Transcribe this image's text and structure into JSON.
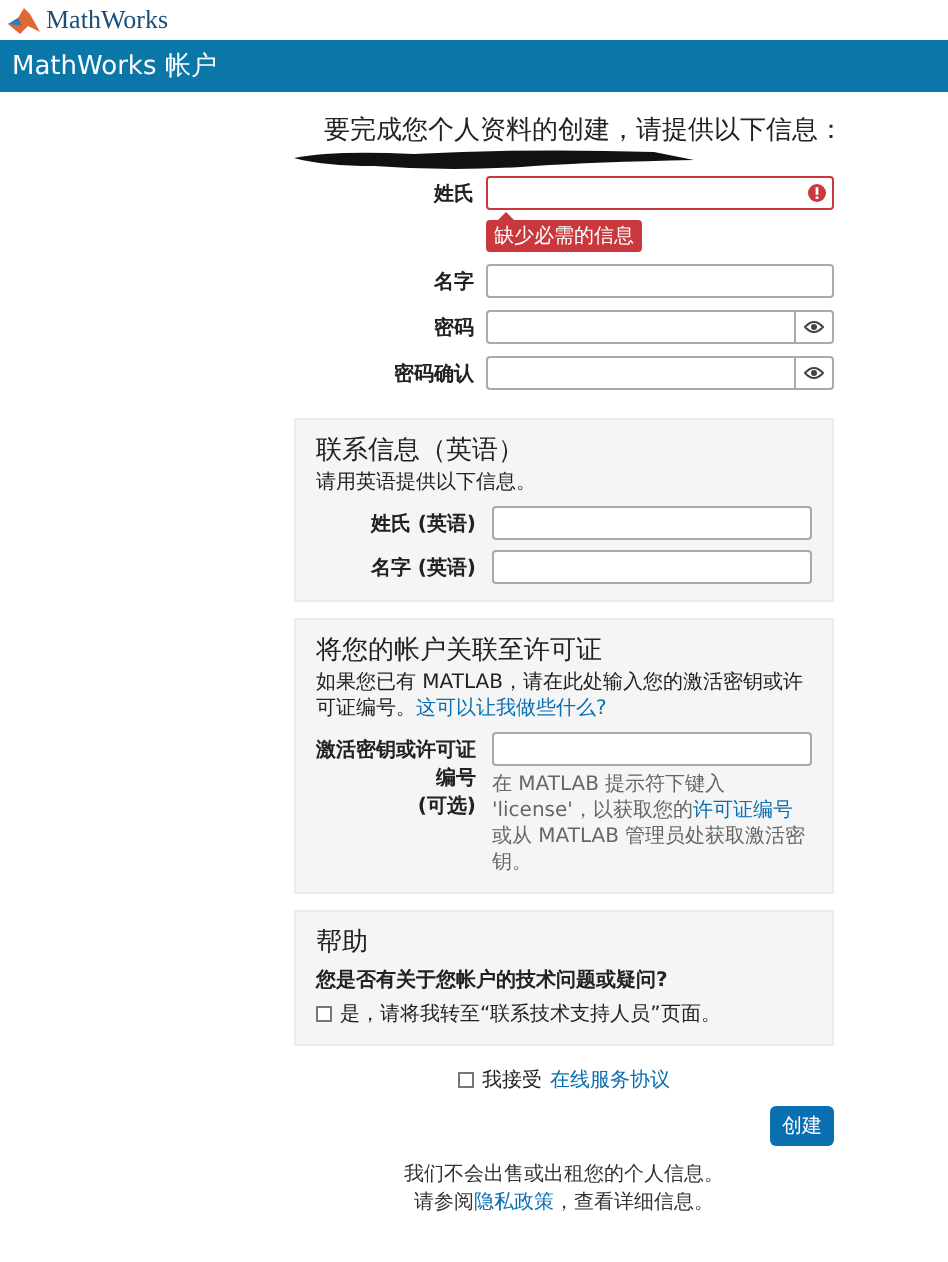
{
  "brand": {
    "logo_text": "MathWorks"
  },
  "header": {
    "title": "MathWorks 帐户"
  },
  "intro": {
    "heading": "要完成您个人资料的创建，请提供以下信息："
  },
  "fields": [
    {
      "label": "姓氏",
      "kind": "text",
      "invalid": true,
      "error": "缺少必需的信息"
    },
    {
      "label": "名字",
      "kind": "text",
      "invalid": false
    },
    {
      "label": "密码",
      "kind": "password",
      "invalid": false
    },
    {
      "label": "密码确认",
      "kind": "password",
      "invalid": false
    }
  ],
  "contact": {
    "title": "联系信息（英语）",
    "note": "请用英语提供以下信息。",
    "fields": [
      {
        "label": "姓氏 (英语)"
      },
      {
        "label": "名字 (英语)"
      }
    ]
  },
  "license": {
    "title": "将您的帐户关联至许可证",
    "description": [
      {
        "kind": "text",
        "text": "如果您已有 MATLAB，请在此处输入您的激活密钥或许可证编号。"
      },
      {
        "kind": "link",
        "text": "这可以让我做些什么?"
      }
    ],
    "field_label": "激活密钥或许可证编号",
    "field_optional": "(可选)",
    "hint": [
      {
        "kind": "text",
        "text": "在 MATLAB 提示符下键入 'license'，以获取您的"
      },
      {
        "kind": "link",
        "text": "许可证编号"
      },
      {
        "kind": "text",
        "text": "或从 MATLAB 管理员处获取激活密钥。"
      }
    ]
  },
  "help": {
    "title": "帮助",
    "question": "您是否有关于您帐户的技术问题或疑问?",
    "checkbox": {
      "label": "是，请将我转至“联系技术支持人员”页面。",
      "checked": false
    }
  },
  "agree": {
    "checked": false,
    "text": "我接受",
    "link": "在线服务协议"
  },
  "submit": {
    "label": "创建"
  },
  "footer": [
    [
      {
        "kind": "text",
        "text": "我们不会出售或出租您的个人信息。"
      }
    ],
    [
      {
        "kind": "text",
        "text": "请参阅"
      },
      {
        "kind": "link",
        "text": "隐私政策"
      },
      {
        "kind": "text",
        "text": "，查看详细信息。"
      }
    ]
  ]
}
